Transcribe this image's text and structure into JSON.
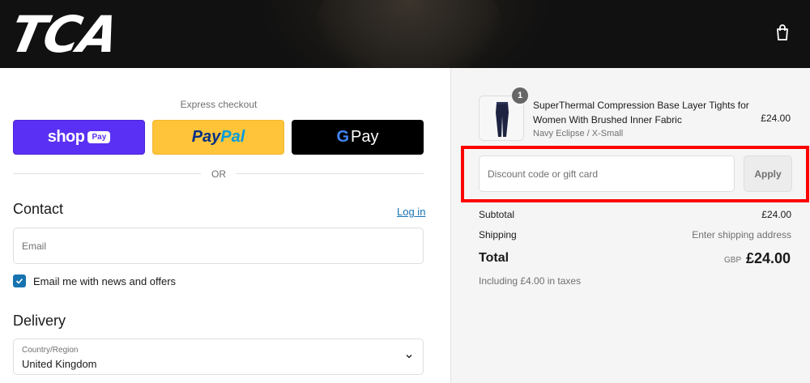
{
  "header": {
    "logo_text": "TCA",
    "cart_icon": "shopping-bag-icon"
  },
  "express": {
    "title": "Express checkout",
    "shop_pay": {
      "label": "shop",
      "badge": "Pay"
    },
    "paypal": {
      "label_part1": "Pay",
      "label_part2": "Pal"
    },
    "gpay": {
      "g": "G",
      "label": "Pay"
    },
    "divider_text": "OR"
  },
  "contact": {
    "title": "Contact",
    "login_link": "Log in",
    "email_placeholder": "Email",
    "newsletter_label": "Email me with news and offers",
    "newsletter_checked": true
  },
  "delivery": {
    "title": "Delivery",
    "country_label": "Country/Region",
    "country_value": "United Kingdom"
  },
  "order": {
    "item": {
      "quantity": "1",
      "name": "SuperThermal Compression Base Layer Tights for Women With Brushed Inner Fabric",
      "variant": "Navy Eclipse / X-Small",
      "price": "£24.00"
    },
    "discount_placeholder": "Discount code or gift card",
    "apply_label": "Apply",
    "subtotal_label": "Subtotal",
    "subtotal_value": "£24.00",
    "shipping_label": "Shipping",
    "shipping_value": "Enter shipping address",
    "total_label": "Total",
    "total_currency": "GBP",
    "total_value": "£24.00",
    "taxes_note": "Including £4.00 in taxes"
  },
  "colors": {
    "accent": "#1773b0",
    "shop_pay": "#5a31f4",
    "paypal": "#ffc439",
    "highlight": "#ff0000"
  }
}
